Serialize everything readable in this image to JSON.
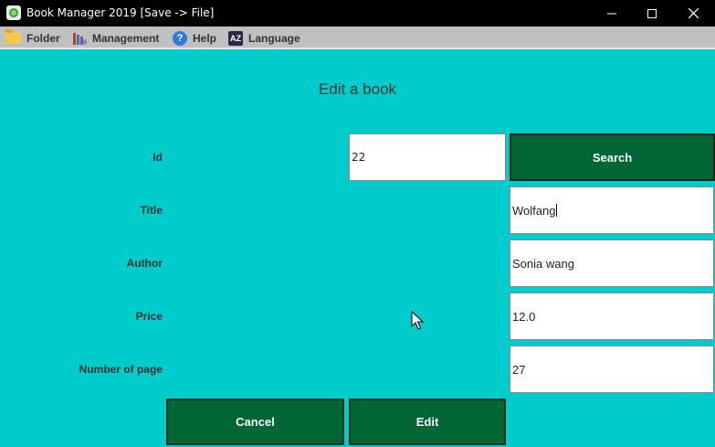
{
  "window": {
    "title": "Book Manager 2019 [Save -> File]",
    "minimize": "—",
    "maximize": "☐",
    "close": "✕"
  },
  "menu": {
    "folder": "Folder",
    "management": "Management",
    "help": "Help",
    "language": "Language",
    "help_icon_glyph": "?",
    "language_icon_glyph": "AZ"
  },
  "form": {
    "title": "Edit a book",
    "id_label": "Id",
    "id_value": "22",
    "search_label": "Search",
    "title_label": "Title",
    "title_value": "Wolfang",
    "author_label": "Author",
    "author_value": "Sonia wang",
    "price_label": "Price",
    "price_value": "12.0",
    "pages_label": "Number of page",
    "pages_value": "27",
    "cancel_label": "Cancel",
    "edit_label": "Edit"
  },
  "colors": {
    "background": "#00cccc",
    "button": "#006633",
    "menubar": "#c0c0c0",
    "titlebar": "#000000"
  }
}
